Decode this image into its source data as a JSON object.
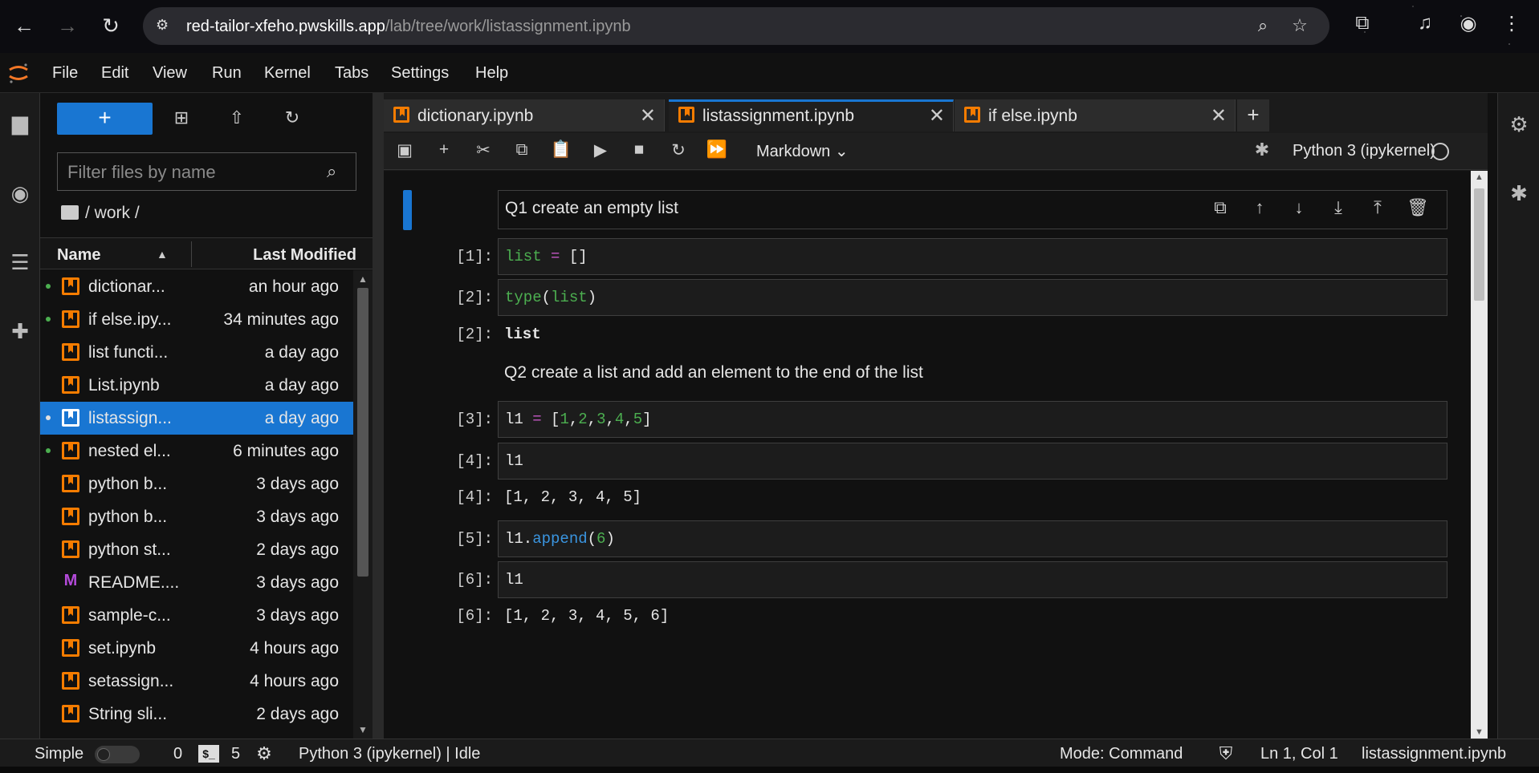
{
  "browser": {
    "url_host": "red-tailor-xfeho.pwskills.app",
    "url_path": "/lab/tree/work/listassignment.ipynb"
  },
  "menu": [
    "File",
    "Edit",
    "View",
    "Run",
    "Kernel",
    "Tabs",
    "Settings",
    "Help"
  ],
  "file_browser": {
    "new_button_label": "+",
    "filter_placeholder": "Filter files by name",
    "breadcrumb": "/ work /",
    "col_name": "Name",
    "col_modified": "Last Modified",
    "files": [
      {
        "name": "dictionar...",
        "modified": "an hour ago",
        "type": "notebook",
        "running": true
      },
      {
        "name": "if else.ipy...",
        "modified": "34 minutes ago",
        "type": "notebook",
        "running": true
      },
      {
        "name": "list functi...",
        "modified": "a day ago",
        "type": "notebook",
        "running": false
      },
      {
        "name": "List.ipynb",
        "modified": "a day ago",
        "type": "notebook",
        "running": false
      },
      {
        "name": "listassign...",
        "modified": "a day ago",
        "type": "notebook",
        "running": true,
        "selected": true
      },
      {
        "name": "nested el...",
        "modified": "6 minutes ago",
        "type": "notebook",
        "running": true
      },
      {
        "name": "python b...",
        "modified": "3 days ago",
        "type": "notebook",
        "running": false
      },
      {
        "name": "python b...",
        "modified": "3 days ago",
        "type": "notebook",
        "running": false
      },
      {
        "name": "python st...",
        "modified": "2 days ago",
        "type": "notebook",
        "running": false
      },
      {
        "name": "README....",
        "modified": "3 days ago",
        "type": "markdown",
        "running": false
      },
      {
        "name": "sample-c...",
        "modified": "3 days ago",
        "type": "notebook",
        "running": false
      },
      {
        "name": "set.ipynb",
        "modified": "4 hours ago",
        "type": "notebook",
        "running": false
      },
      {
        "name": "setassign...",
        "modified": "4 hours ago",
        "type": "notebook",
        "running": false
      },
      {
        "name": "String sli...",
        "modified": "2 days ago",
        "type": "notebook",
        "running": false
      }
    ]
  },
  "tabs": [
    {
      "label": "dictionary.ipynb",
      "active": false
    },
    {
      "label": "listassignment.ipynb",
      "active": true
    },
    {
      "label": "if else.ipynb",
      "active": false
    }
  ],
  "toolbar": {
    "cell_type": "Markdown",
    "kernel": "Python 3 (ipykernel)"
  },
  "cells": {
    "md1": "Q1 create an empty list",
    "c1_prompt": "[1]:",
    "c2_prompt": "[2]:",
    "o2_prompt": "[2]:",
    "o2_text": "list",
    "md2": "Q2 create a list and add an element to the end of the list",
    "c3_prompt": "[3]:",
    "c4_prompt": "[4]:",
    "c4_code": "l1",
    "o4_prompt": "[4]:",
    "o4_text": "[1, 2, 3, 4, 5]",
    "c5_prompt": "[5]:",
    "c6_prompt": "[6]:",
    "c6_code": "l1",
    "o6_prompt": "[6]:",
    "o6_text": "[1, 2, 3, 4, 5, 6]"
  },
  "statusbar": {
    "simple_label": "Simple",
    "terminals_count": "0",
    "kernels_count": "5",
    "kernel_status": "Python 3 (ipykernel) | Idle",
    "mode": "Mode: Command",
    "cursor": "Ln 1, Col 1",
    "filename": "listassignment.ipynb"
  }
}
